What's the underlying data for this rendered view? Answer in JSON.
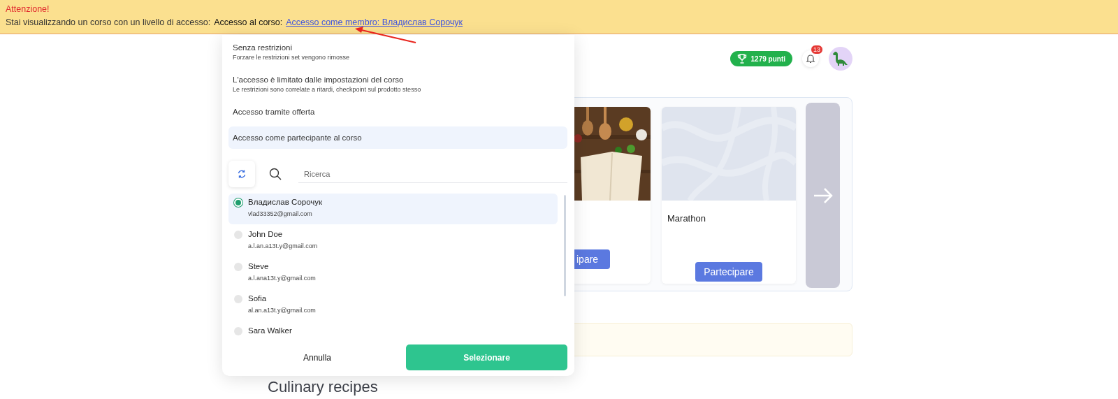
{
  "banner": {
    "title": "Attenzione!",
    "message": "Stai visualizzando un corso con un livello di accesso:",
    "label": "Accesso al corso:",
    "link": "Accesso come membro: Владислав Сорочук"
  },
  "header": {
    "points": "1279 punti",
    "notifications": "13"
  },
  "courses": [
    {
      "kind": "picture",
      "button": "ipare"
    },
    {
      "kind": "pattern",
      "title": "Marathon",
      "button": "Partecipare"
    }
  ],
  "section_title": "Culinary recipes",
  "access_panel": {
    "options": [
      {
        "title": "Senza restrizioni",
        "subtitle": "Forzare le restrizioni set vengono rimosse",
        "selected": false
      },
      {
        "title": "L'accesso è limitato dalle impostazioni del corso",
        "subtitle": "Le restrizioni sono correlate a ritardi, checkpoint sul prodotto stesso",
        "selected": false
      },
      {
        "title": "Accesso tramite offerta",
        "selected": false
      },
      {
        "title": "Accesso come partecipante al corso",
        "selected": true
      }
    ],
    "search": {
      "placeholder": "Ricerca"
    },
    "members": [
      {
        "name": "Владислав Сорочук",
        "email": "vlad33352@gmail.com",
        "selected": true
      },
      {
        "name": "John Doe",
        "email": "a.l.an.a13t.y@gmail.com",
        "selected": false
      },
      {
        "name": "Steve",
        "email": "a.l.ana13t.y@gmail.com",
        "selected": false
      },
      {
        "name": "Sofia",
        "email": "al.an.a13t.y@gmail.com",
        "selected": false
      },
      {
        "name": "Sara Walker",
        "selected": false
      }
    ],
    "buttons": {
      "cancel": "Annulla",
      "confirm": "Selezionare"
    }
  }
}
